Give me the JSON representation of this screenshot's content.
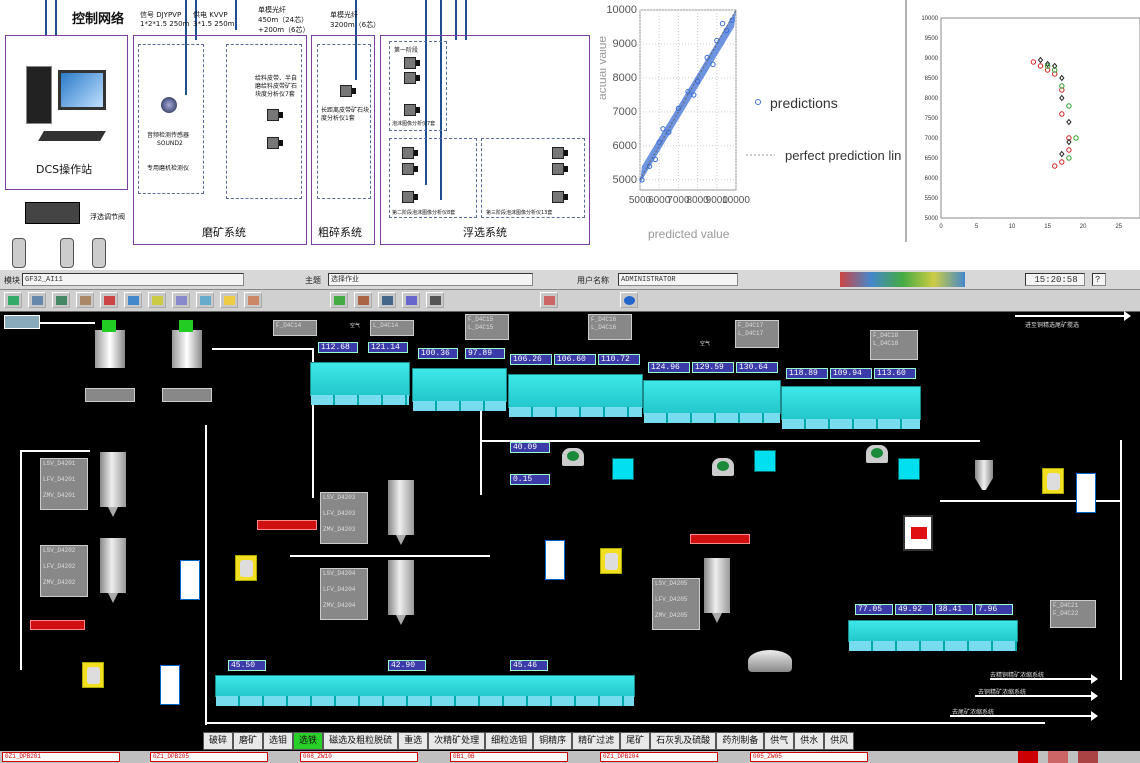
{
  "diagram": {
    "control_network": "控制网络",
    "dcs_station": "DCS操作站",
    "flotation_valve": "浮选调节阀",
    "signal_cable": "信号 DJYPVP",
    "signal_cable_spec": "1*2*1.5 250m",
    "power_cable": "供电 KVVP",
    "power_cable_spec": "3*1.5 250m",
    "single_fiber_a": "单模光纤",
    "single_fiber_a_spec1": "450m（24芯）",
    "single_fiber_a_spec2": "+200m（6芯）",
    "single_fiber_b": "单模光纤",
    "single_fiber_b_spec": "3200m（6芯）",
    "sound_sensor": "音频检测传感器",
    "sound_model": "SOUND2",
    "mill_meter": "专用磨机检测仪",
    "belt_analyzers": "给料皮带、半自磨给料皮带矿石块度分析仪7套",
    "long_belt_analyzer": "长距离皮带矿石块度分析仪1套",
    "stage1": "第一阶段",
    "foam_analyzer_7": "泡沫图像分析仪7套",
    "foam_analyzer_stage2": "第二阶段泡沫图像分析仪8套",
    "foam_analyzer_stage3": "第三阶段泡沫图像分析仪13套",
    "grinding_system": "磨矿系统",
    "crushing_system": "粗碎系统",
    "flotation_system": "浮选系统"
  },
  "chart_data": [
    {
      "type": "scatter",
      "xlabel": "predicted value",
      "ylabel": "actual value",
      "xticks": [
        "5000",
        "6000",
        "7000",
        "8000",
        "9000",
        "10000"
      ],
      "yticks": [
        "5000",
        "6000",
        "7000",
        "8000",
        "9000",
        "10000"
      ],
      "xlim": [
        5000,
        10000
      ],
      "ylim": [
        4700,
        10000
      ],
      "legend": [
        "predictions",
        "perfect prediction line"
      ],
      "legend_position": "right",
      "series": [
        {
          "name": "predictions",
          "x": [
            5100,
            5500,
            6000,
            6500,
            7000,
            7500,
            8000,
            8500,
            9000,
            9500,
            9800,
            6200,
            7800,
            8800,
            5800,
            9300
          ],
          "y": [
            5000,
            5400,
            6100,
            6400,
            7100,
            7600,
            7900,
            8600,
            9100,
            9400,
            9700,
            6500,
            7500,
            8400,
            5600,
            9600
          ]
        }
      ]
    },
    {
      "type": "scatter",
      "xticks": [
        "0",
        "5",
        "10",
        "15",
        "20",
        "25"
      ],
      "yticks": [
        "5000",
        "5500",
        "6000",
        "6500",
        "7000",
        "7500",
        "8000",
        "8500",
        "9000",
        "9500",
        "10000"
      ],
      "xlim": [
        0,
        28
      ],
      "ylim": [
        5000,
        10000
      ],
      "series": [
        {
          "x": [
            13,
            14,
            15,
            16,
            17,
            17,
            18,
            18,
            17,
            16
          ],
          "y": [
            8900,
            8800,
            8700,
            8600,
            8200,
            7600,
            7000,
            6700,
            6400,
            6300
          ]
        },
        {
          "x": [
            14,
            15,
            16,
            17,
            17,
            18,
            18,
            17
          ],
          "y": [
            8950,
            8850,
            8800,
            8500,
            8000,
            7400,
            6900,
            6600
          ]
        },
        {
          "x": [
            15,
            16,
            17,
            18,
            19,
            18
          ],
          "y": [
            8800,
            8700,
            8300,
            7800,
            7000,
            6500
          ]
        }
      ]
    }
  ],
  "scada": {
    "module_label": "模块",
    "module_value": "GF32_AI11",
    "theme_label": "主题",
    "theme_value": "选择作业",
    "user_label": "用户名称",
    "user_value": "ADMINISTRATOR",
    "clock": "15:20:58",
    "help": "?",
    "flow_values": [
      "112.68",
      "121.14",
      "100.36",
      "97.89",
      "106.26",
      "106.60",
      "110.72",
      "124.96",
      "129.59",
      "130.64",
      "118.89",
      "109.94",
      "113.60"
    ],
    "bottom_values": [
      "45.50",
      "42.90",
      "45.46"
    ],
    "right_values": [
      "77.05",
      "49.92",
      "38.41",
      "7.96"
    ],
    "pump_values": [
      "40.09",
      "0.15"
    ],
    "air_label": "空气",
    "to_tail": "进至铜精选尾矿搅选",
    "to_copper1": "去精铜精矿浓缩系统",
    "to_copper2": "去铜精矿浓缩系统",
    "to_tail2": "去尾矿浓缩系统",
    "side_tags": [
      "LSV_D4201",
      "LFV_D4201",
      "ZMV_D4201",
      "LSV_D4202",
      "LFV_D4202",
      "ZMV_D4202",
      "LSV_D4203",
      "LFV_D4203",
      "ZMV_D4203",
      "LSV_D4204",
      "LFV_D4204",
      "ZMV_D4204",
      "LSV_D4205",
      "LFV_D4205",
      "ZMV_D4205"
    ],
    "tags": [
      "F_D4C14",
      "L_D4C14",
      "F_D4C15",
      "L_D4C15",
      "F_D4C16",
      "L_D4C16",
      "F_D4C17",
      "L_D4C17",
      "F_D4C18",
      "L_D4C18",
      "F_D4C21",
      "F_D4C22"
    ]
  },
  "tabs": [
    "破碎",
    "磨矿",
    "选钼",
    "选铁",
    "磁选及粗粒脱硫",
    "重选",
    "次精矿处理",
    "细粒选钼",
    "铜精序",
    "精矿过滤",
    "尾矿",
    "石灰乳及硫酸",
    "药剂制备",
    "供气",
    "供水",
    "供风"
  ],
  "active_tab": "选铁",
  "alarms": [
    "0Z1_DPB201",
    "0Z1_DPB205",
    "008_ZW10",
    "0B1_0B",
    "0Z1_DPB204",
    "005_ZW05"
  ]
}
